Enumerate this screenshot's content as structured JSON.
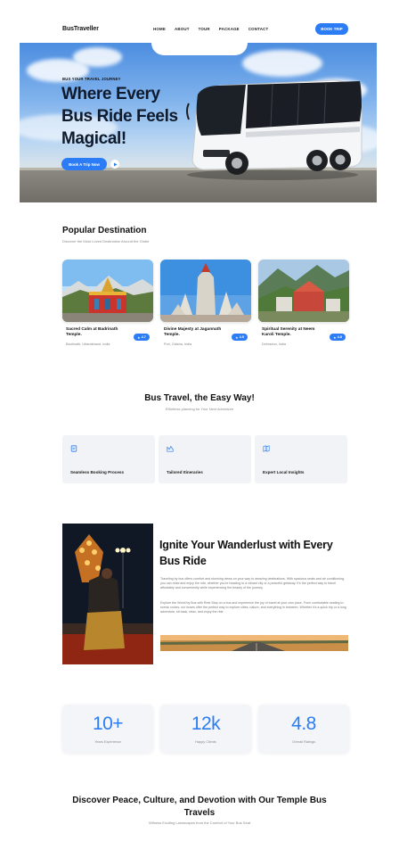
{
  "nav": {
    "logo": "BusTraveller",
    "links": [
      "HOME",
      "ABOUT",
      "TOUR",
      "PACKAGE",
      "CONTACT"
    ],
    "book_button": "BOOK TRIP"
  },
  "hero": {
    "eyebrow": "BUS YOUR TRAVEL JOURNEY",
    "title": "Where Every Bus Ride Feels Magical!",
    "cta": "Book A Trip Now",
    "play_icon": "play-icon"
  },
  "popular": {
    "title": "Popular Destination",
    "subtitle": "Discover the Most Loved Destination Around the Globe",
    "cards": [
      {
        "title": "Sacred Calm at Badrinath Temple.",
        "location": "Badrinath, Uttarakhand, India",
        "rating": "4.7"
      },
      {
        "title": "Divine Majesty at Jagannath Temple.",
        "location": "Puri, Odisha, India",
        "rating": "4.5"
      },
      {
        "title": "Spiritual Serenity at Neem Karoli Temple.",
        "location": "Dehradun, India",
        "rating": "4.8"
      }
    ]
  },
  "easy": {
    "title": "Bus Travel, the Easy Way!",
    "subtitle": "Effortless planning for Your Next Adventure",
    "features": [
      {
        "label": "Seamless Booking Process",
        "icon": "booking-icon"
      },
      {
        "label": "Tailored Itineraries",
        "icon": "itinerary-icon"
      },
      {
        "label": "Expert Local Insights",
        "icon": "map-icon"
      }
    ]
  },
  "wanderlust": {
    "title": "Ignite Your Wanderlust with Every Bus Ride",
    "para1": "Traveling by bus offers comfort and stunning views on your way to amazing destinations. With spacious seats and air conditioning, you can relax and enjoy the ride, whether you're heading to a vibrant city or a peaceful getaway. It's the perfect way to travel affordably and conveniently while experiencing the beauty of the journey.",
    "para2": "Explore the World by Bus with Rest Stop on a bus and experience the joy of travel at your own pace. From comfortable seating to scenic routes, our buses offer the perfect way to explore cities, nature, and everything in between. Whether it's a quick trip or a long adventure, sit back, relax, and enjoy the ride."
  },
  "stats": [
    {
      "value": "10+",
      "label": "Years Experience"
    },
    {
      "value": "12k",
      "label": "Happy Clients"
    },
    {
      "value": "4.8",
      "label": "Overall Ratings"
    }
  ],
  "discover": {
    "title": "Discover Peace, Culture, and Devotion with Our Temple Bus Travels",
    "subtitle": "Witness Exciting Landscapes from the Comfort of Your Bus Seat"
  },
  "colors": {
    "accent": "#2b7cf5",
    "card_bg": "#f1f3f6"
  }
}
